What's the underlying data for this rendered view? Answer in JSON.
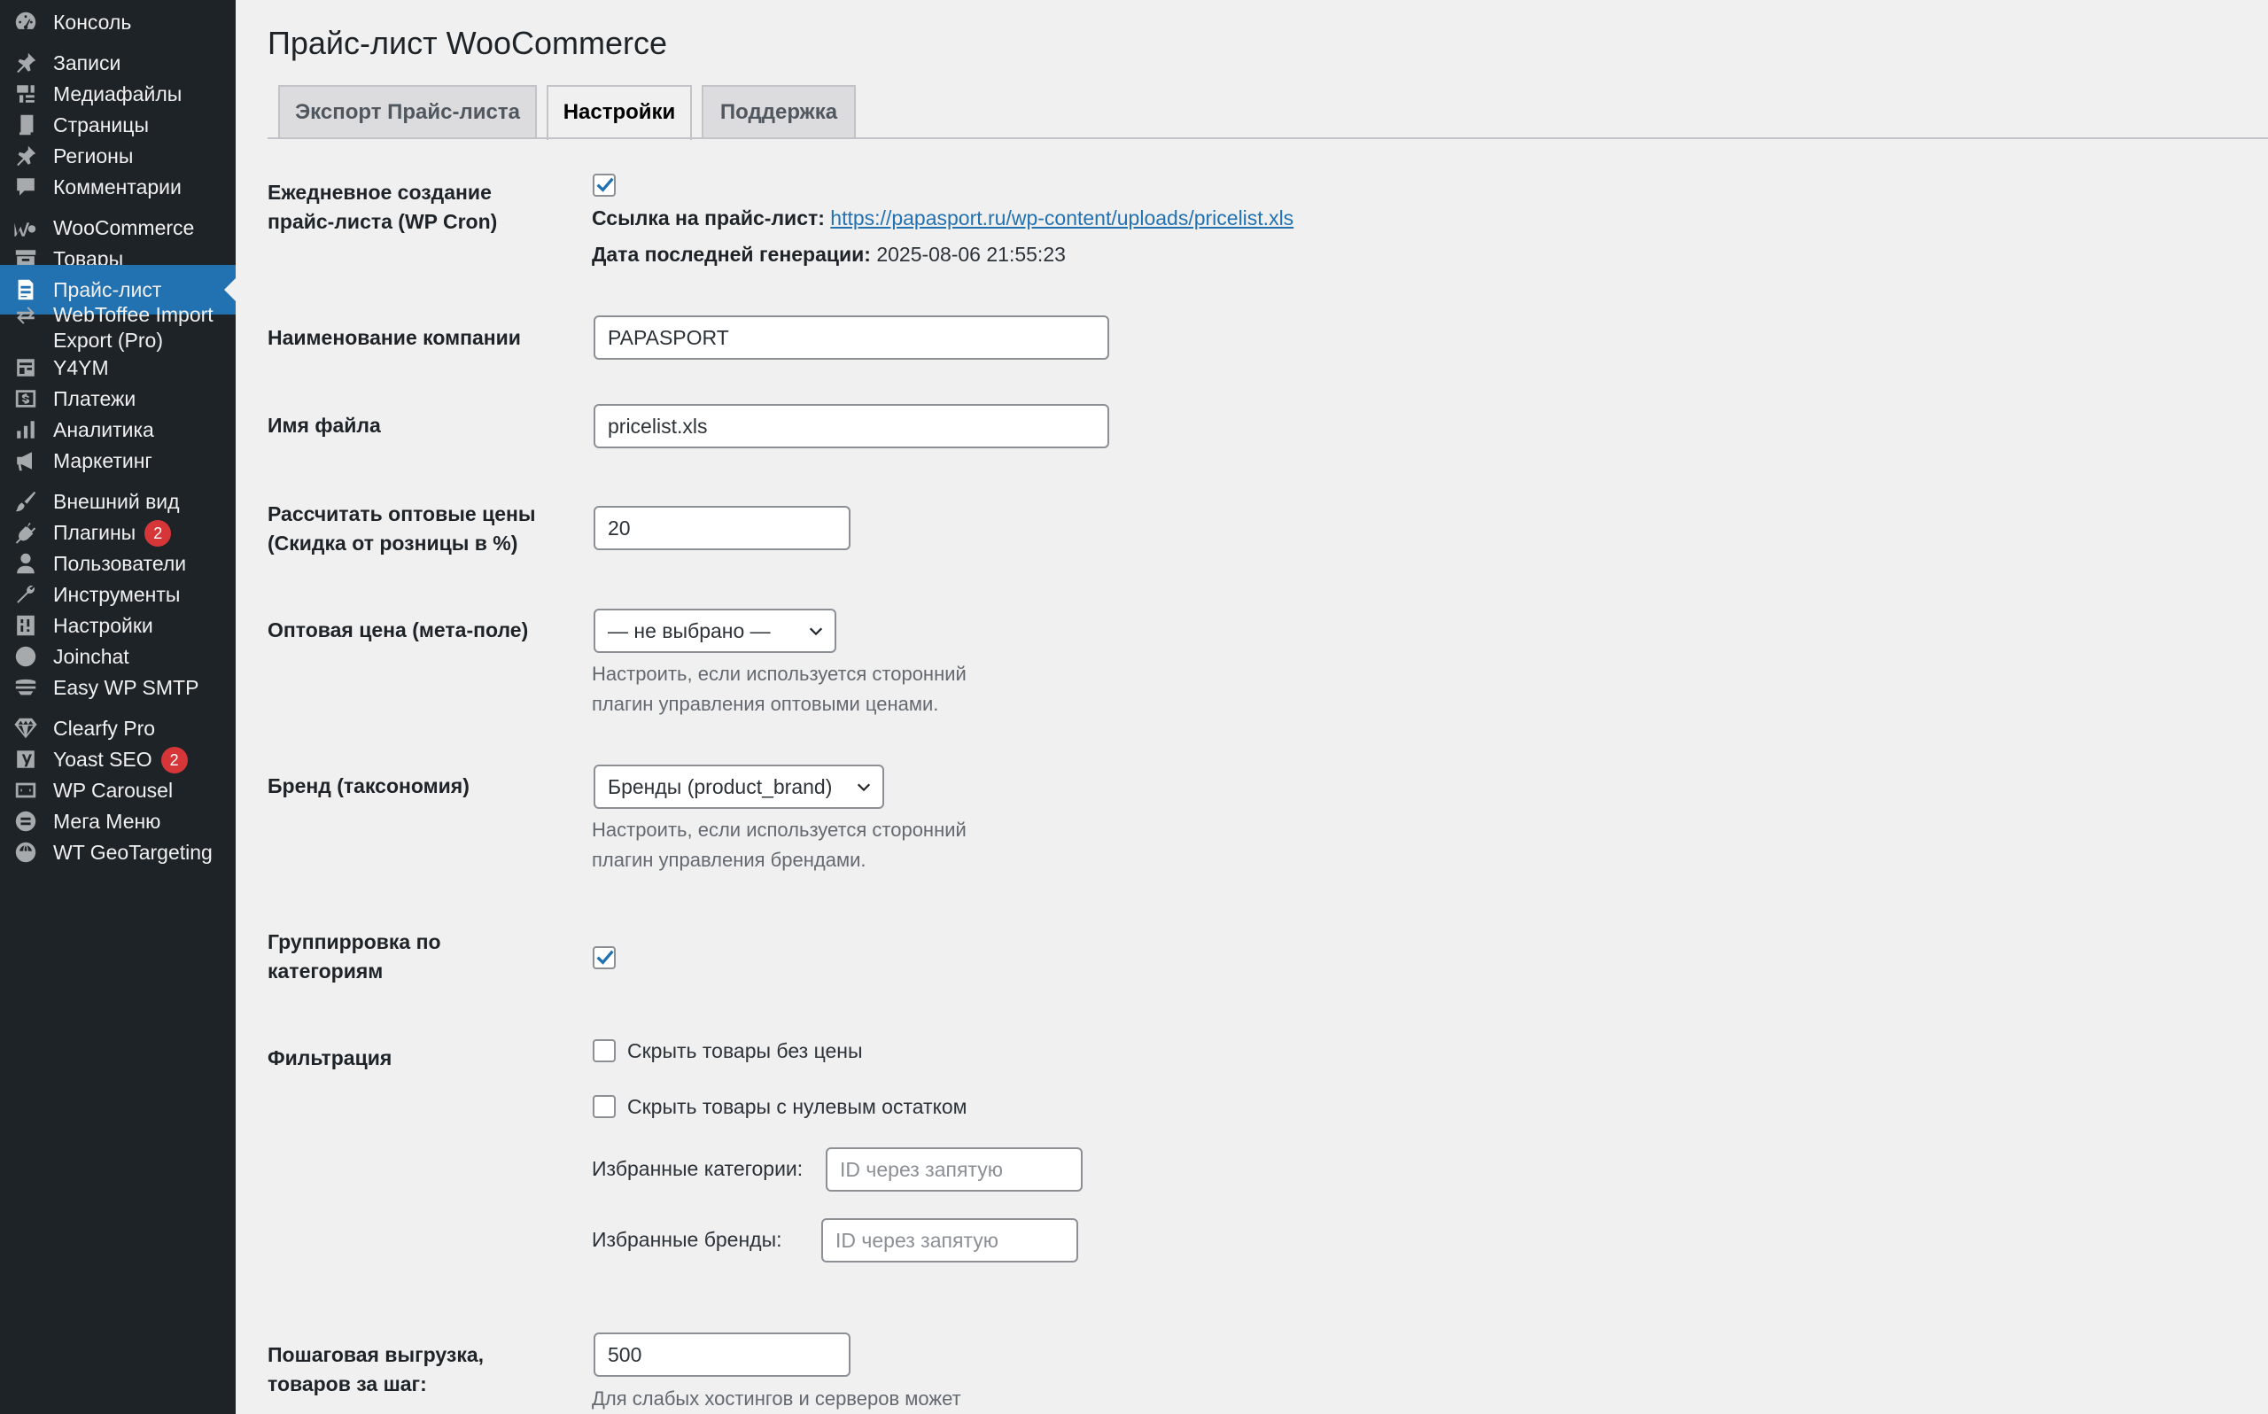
{
  "sidebar": {
    "items": [
      {
        "label": "Консоль",
        "icon": "dashboard-icon"
      },
      {
        "label": "Записи",
        "icon": "pin-icon"
      },
      {
        "label": "Медиафайлы",
        "icon": "media-icon"
      },
      {
        "label": "Страницы",
        "icon": "pages-icon"
      },
      {
        "label": "Регионы",
        "icon": "pin-icon"
      },
      {
        "label": "Комментарии",
        "icon": "comment-icon"
      },
      {
        "label": "WooCommerce",
        "icon": "woocommerce-icon"
      },
      {
        "label": "Товары",
        "icon": "archive-icon"
      },
      {
        "label": "Прайс-лист",
        "icon": "document-icon"
      },
      {
        "label": "WebToffee Import",
        "label2": "Export (Pro)",
        "icon": "import-export-icon"
      },
      {
        "label": "Y4YM",
        "icon": "feed-icon"
      },
      {
        "label": "Платежи",
        "icon": "dollar-icon"
      },
      {
        "label": "Аналитика",
        "icon": "bar-chart-icon"
      },
      {
        "label": "Маркетинг",
        "icon": "megaphone-icon"
      },
      {
        "label": "Внешний вид",
        "icon": "brush-icon"
      },
      {
        "label": "Плагины",
        "icon": "plugin-icon",
        "badge": "2"
      },
      {
        "label": "Пользователи",
        "icon": "user-icon"
      },
      {
        "label": "Инструменты",
        "icon": "wrench-icon"
      },
      {
        "label": "Настройки",
        "icon": "settings-icon"
      },
      {
        "label": "Joinchat",
        "icon": "chat-icon"
      },
      {
        "label": "Easy WP SMTP",
        "icon": "mail-icon"
      },
      {
        "label": "Clearfy Pro",
        "icon": "diamond-icon"
      },
      {
        "label": "Yoast SEO",
        "icon": "yoast-icon",
        "badge": "2"
      },
      {
        "label": "WP Carousel",
        "icon": "carousel-icon"
      },
      {
        "label": "Мега Меню",
        "icon": "menu-icon"
      },
      {
        "label": "WT GeoTargeting",
        "icon": "globe-icon"
      }
    ]
  },
  "page": {
    "title": "Прайс-лист WooCommerce",
    "tabs": [
      "Экспорт Прайс-листа",
      "Настройки",
      "Поддержка"
    ]
  },
  "cron": {
    "label1": "Ежедневное создание",
    "label2": "прайс-листа (WP Cron)",
    "checked": true,
    "link_label": "Ссылка на прайс-лист:",
    "link_url": "https://papasport.ru/wp-content/uploads/pricelist.xls",
    "date_label": "Дата последней генерации:",
    "date_value": "2025-08-06 21:55:23"
  },
  "company": {
    "label": "Наименование компании",
    "value": "PAPASPORT"
  },
  "filename": {
    "label": "Имя файла",
    "value": "pricelist.xls"
  },
  "wholesale": {
    "label1": "Рассчитать оптовые цены",
    "label2": "(Скидка от розницы в %)",
    "value": "20"
  },
  "meta": {
    "label": "Оптовая цена (мета-поле)",
    "selected": "— не выбрано —",
    "desc1": "Настроить, если используется сторонний",
    "desc2": "плагин управления оптовыми ценами."
  },
  "brand": {
    "label": "Бренд (таксономия)",
    "selected": "Бренды (product_brand)",
    "desc1": "Настроить, если используется сторонний",
    "desc2": "плагин управления брендами."
  },
  "grouping": {
    "label1": "Группирровка по",
    "label2": "категориям",
    "checked": true
  },
  "filter": {
    "label": "Фильтрация",
    "hide_no_price": "Скрыть товары без цены",
    "hide_zero_stock": "Скрыть товары с нулевым остатком",
    "fav_categories_label": "Избранные категории:",
    "fav_categories_placeholder": "ID через запятую",
    "fav_brands_label": "Избранные бренды:",
    "fav_brands_placeholder": "ID через запятую"
  },
  "step": {
    "label1": "Пошаговая выгрузка,",
    "label2": "товаров за шаг:",
    "value": "500",
    "desc": "Для слабых хостингов и серверов может"
  },
  "colors": {
    "sidebar_bg": "#1d2327",
    "accent": "#2271b1",
    "badge": "#d63638",
    "page_bg": "#f0f0f1"
  }
}
